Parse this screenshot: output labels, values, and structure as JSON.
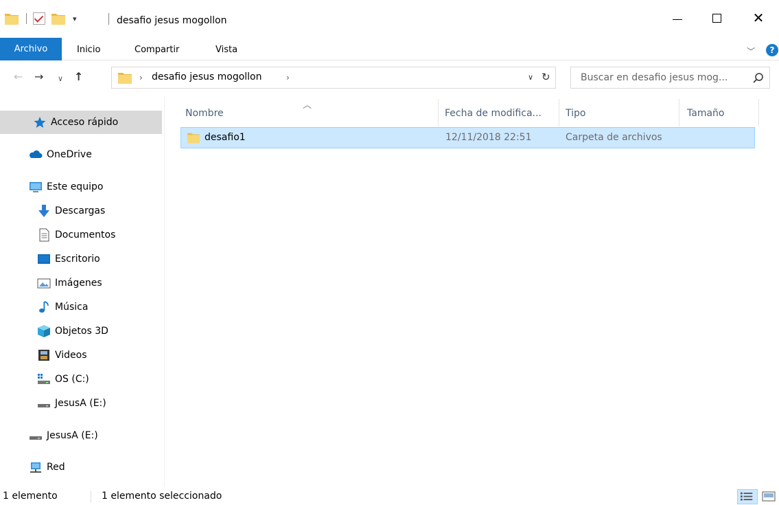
{
  "window": {
    "title": "desafio jesus mogollon"
  },
  "ribbon": {
    "tabs": [
      "Archivo",
      "Inicio",
      "Compartir",
      "Vista"
    ]
  },
  "address_bar": {
    "path": "desafio jesus mogollon",
    "search_placeholder": "Buscar en desafio jesus mog..."
  },
  "sidebar": {
    "quick_access": "Acceso rápido",
    "onedrive": "OneDrive",
    "this_pc": "Este equipo",
    "pc_items": [
      "Descargas",
      "Documentos",
      "Escritorio",
      "Imágenes",
      "Música",
      "Objetos 3D",
      "Videos",
      "OS (C:)",
      "JesusA (E:)"
    ],
    "drive": "JesusA (E:)",
    "network": "Red"
  },
  "file_list": {
    "columns": [
      "Nombre",
      "Fecha de modifica...",
      "Tipo",
      "Tamaño"
    ],
    "rows": [
      {
        "name": "desafio1",
        "date": "12/11/2018 22:51",
        "type": "Carpeta de archivos",
        "size": ""
      }
    ]
  },
  "status_bar": {
    "count": "1 elemento",
    "selected": "1 elemento seleccionado"
  },
  "colors": {
    "accent": "#1979ca",
    "selection": "#cce8ff",
    "folder": "#f8d775"
  }
}
